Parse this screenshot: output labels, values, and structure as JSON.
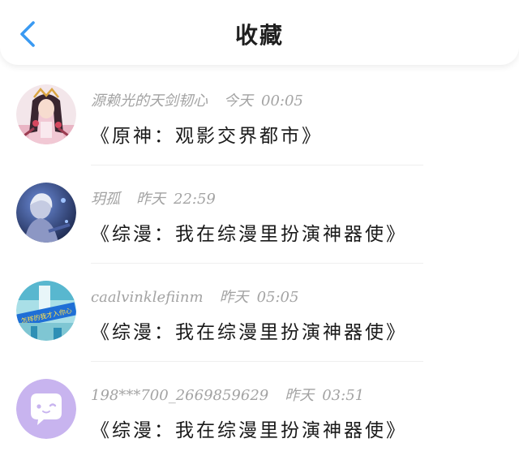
{
  "header": {
    "title": "收藏",
    "back_icon": "chevron-left-icon",
    "accent_color": "#3a9af2"
  },
  "favorites": [
    {
      "user": "源赖光的天剑韧心",
      "day": "今天",
      "time": "00:05",
      "book_title": "《原神：观影交界都市》",
      "avatar": "anime-character-avatar"
    },
    {
      "user": "玥孤",
      "day": "昨天",
      "time": "22:59",
      "book_title": "《综漫：我在综漫里扮演神器使》",
      "avatar": "dark-blue-character-avatar"
    },
    {
      "user": "caalvinklefiinm",
      "day": "昨天",
      "time": "05:05",
      "book_title": "《综漫：我在综漫里扮演神器使》",
      "avatar": "banner-photo-avatar",
      "avatar_text": "怎样的我才入你心"
    },
    {
      "user": "198***700_2669859629",
      "day": "昨天",
      "time": "03:51",
      "book_title": "《综漫：我在综漫里扮演神器使》",
      "avatar": "chat-bubble-avatar",
      "avatar_color": "#c8b4ef"
    }
  ]
}
